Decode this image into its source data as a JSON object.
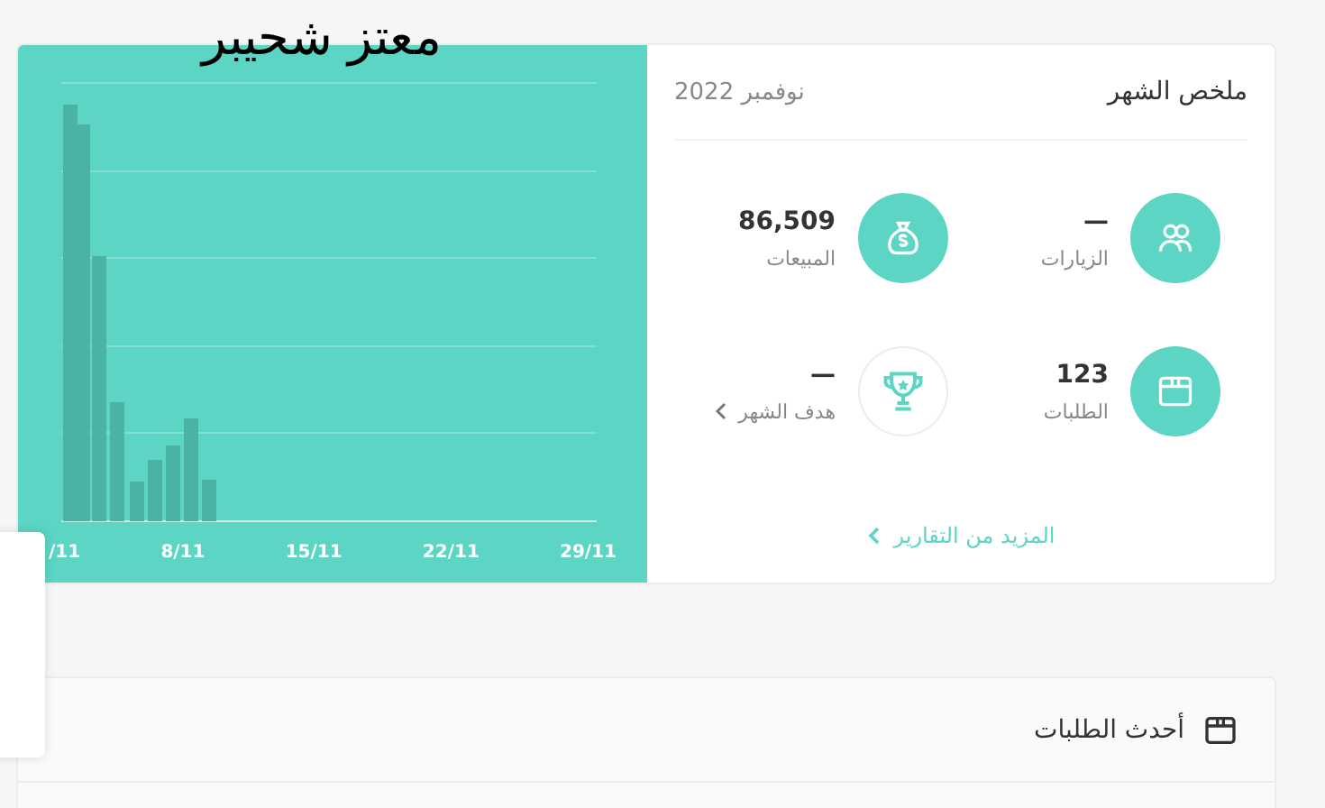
{
  "overlay_title": "معتز شحيبر",
  "chart": {
    "x_labels": [
      "29/11",
      "22/11",
      "15/11",
      "8/11",
      "/11"
    ]
  },
  "summary": {
    "title": "ملخص الشهر",
    "period": "نوفمبر 2022",
    "stats": [
      {
        "value": "—",
        "label": "الزيارات",
        "kind": "filled",
        "link": false
      },
      {
        "value": "86,509",
        "label": "المبيعات",
        "kind": "filled",
        "link": false
      },
      {
        "value": "123",
        "label": "الطلبات",
        "kind": "filled",
        "link": false
      },
      {
        "value": "—",
        "label": "هدف الشهر",
        "kind": "outline",
        "link": true
      }
    ],
    "more_link": "المزيد من التقارير"
  },
  "latest_orders": {
    "title": "أحدث الطلبات"
  }
}
